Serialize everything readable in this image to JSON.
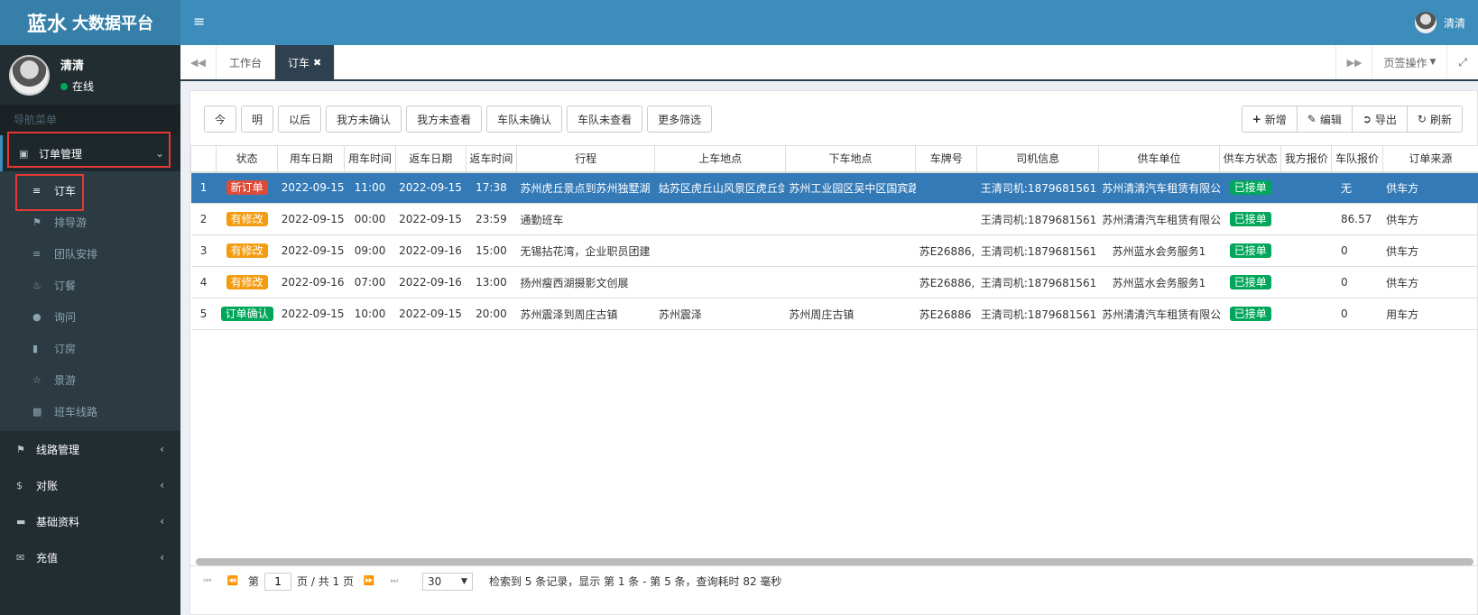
{
  "brand": {
    "big": "蓝水",
    "small": "大数据平台"
  },
  "user": {
    "name": "清清",
    "status": "在线"
  },
  "nav_header": "导航菜单",
  "menu": {
    "order_mgmt": "订单管理",
    "subitems": [
      "订车",
      "排导游",
      "团队安排",
      "订餐",
      "询问",
      "订房",
      "景游",
      "班车线路"
    ],
    "route_mgmt": "线路管理",
    "reconcile": "对账",
    "basic_data": "基础资料",
    "recharge": "充值"
  },
  "tabs": {
    "workbench": "工作台",
    "active": "订车",
    "page_ops": "页签操作"
  },
  "filters": [
    "今",
    "明",
    "以后",
    "我方未确认",
    "我方未查看",
    "车队未确认",
    "车队未查看",
    "更多筛选"
  ],
  "actions": {
    "add": "新增",
    "edit": "编辑",
    "export": "导出",
    "refresh": "刷新"
  },
  "columns": [
    "",
    "状态",
    "用车日期",
    "用车时间",
    "返车日期",
    "返车时间",
    "行程",
    "上车地点",
    "下车地点",
    "车牌号",
    "司机信息",
    "供车单位",
    "供车方状态",
    "我方报价",
    "车队报价",
    "订单来源"
  ],
  "rows": [
    {
      "no": "1",
      "status": "新订单",
      "status_color": "#dd4b39",
      "date": "2022-09-15",
      "time": "11:00",
      "rdate": "2022-09-15",
      "rtime": "17:38",
      "trip": "苏州虎丘景点到苏州独墅湖",
      "pickup": "姑苏区虎丘山风景区虎丘剑",
      "dropoff": "苏州工业园区吴中区国宾路",
      "plate": "",
      "driver": "王清司机:1879681561",
      "unit": "苏州清清汽车租赁有限公",
      "supplier_status": "已接单",
      "our_price": "",
      "fleet_price": "无",
      "source": "供车方"
    },
    {
      "no": "2",
      "status": "有修改",
      "status_color": "#f39c12",
      "date": "2022-09-15",
      "time": "00:00",
      "rdate": "2022-09-15",
      "rtime": "23:59",
      "trip": "通勤班车",
      "pickup": "",
      "dropoff": "",
      "plate": "",
      "driver": "王清司机:1879681561",
      "unit": "苏州清清汽车租赁有限公",
      "supplier_status": "已接单",
      "our_price": "",
      "fleet_price": "86.57",
      "source": "供车方"
    },
    {
      "no": "3",
      "status": "有修改",
      "status_color": "#f39c12",
      "date": "2022-09-15",
      "time": "09:00",
      "rdate": "2022-09-16",
      "rtime": "15:00",
      "trip": "无锡拈花湾，企业职员团建",
      "pickup": "",
      "dropoff": "",
      "plate": "苏E26886,",
      "driver": "王清司机:1879681561",
      "unit": "苏州蓝水会务服务1",
      "supplier_status": "已接单",
      "our_price": "",
      "fleet_price": "0",
      "source": "供车方"
    },
    {
      "no": "4",
      "status": "有修改",
      "status_color": "#f39c12",
      "date": "2022-09-16",
      "time": "07:00",
      "rdate": "2022-09-16",
      "rtime": "13:00",
      "trip": "扬州瘦西湖摄影文创展",
      "pickup": "",
      "dropoff": "",
      "plate": "苏E26886,",
      "driver": "王清司机:1879681561",
      "unit": "苏州蓝水会务服务1",
      "supplier_status": "已接单",
      "our_price": "",
      "fleet_price": "0",
      "source": "供车方"
    },
    {
      "no": "5",
      "status": "订单确认",
      "status_color": "#00a65a",
      "date": "2022-09-15",
      "time": "10:00",
      "rdate": "2022-09-15",
      "rtime": "20:00",
      "trip": "苏州震泽到周庄古镇",
      "pickup": "苏州震泽",
      "dropoff": "苏州周庄古镇",
      "plate": "苏E26886",
      "driver": "王清司机:1879681561",
      "unit": "苏州清清汽车租赁有限公",
      "supplier_status": "已接单",
      "our_price": "",
      "fleet_price": "0",
      "source": "用车方"
    }
  ],
  "pager": {
    "page_label": "第",
    "page_value": "1",
    "total_label": "页 / 共 1 页",
    "page_size": "30",
    "summary": "检索到 5 条记录，显示 第 1 条 - 第 5 条，查询耗时 82 毫秒"
  },
  "colors": {
    "sidebar": "#222d32",
    "topbar": "#3c8dbc",
    "selected_row": "#337ab7",
    "accepted": "#00a65a"
  }
}
